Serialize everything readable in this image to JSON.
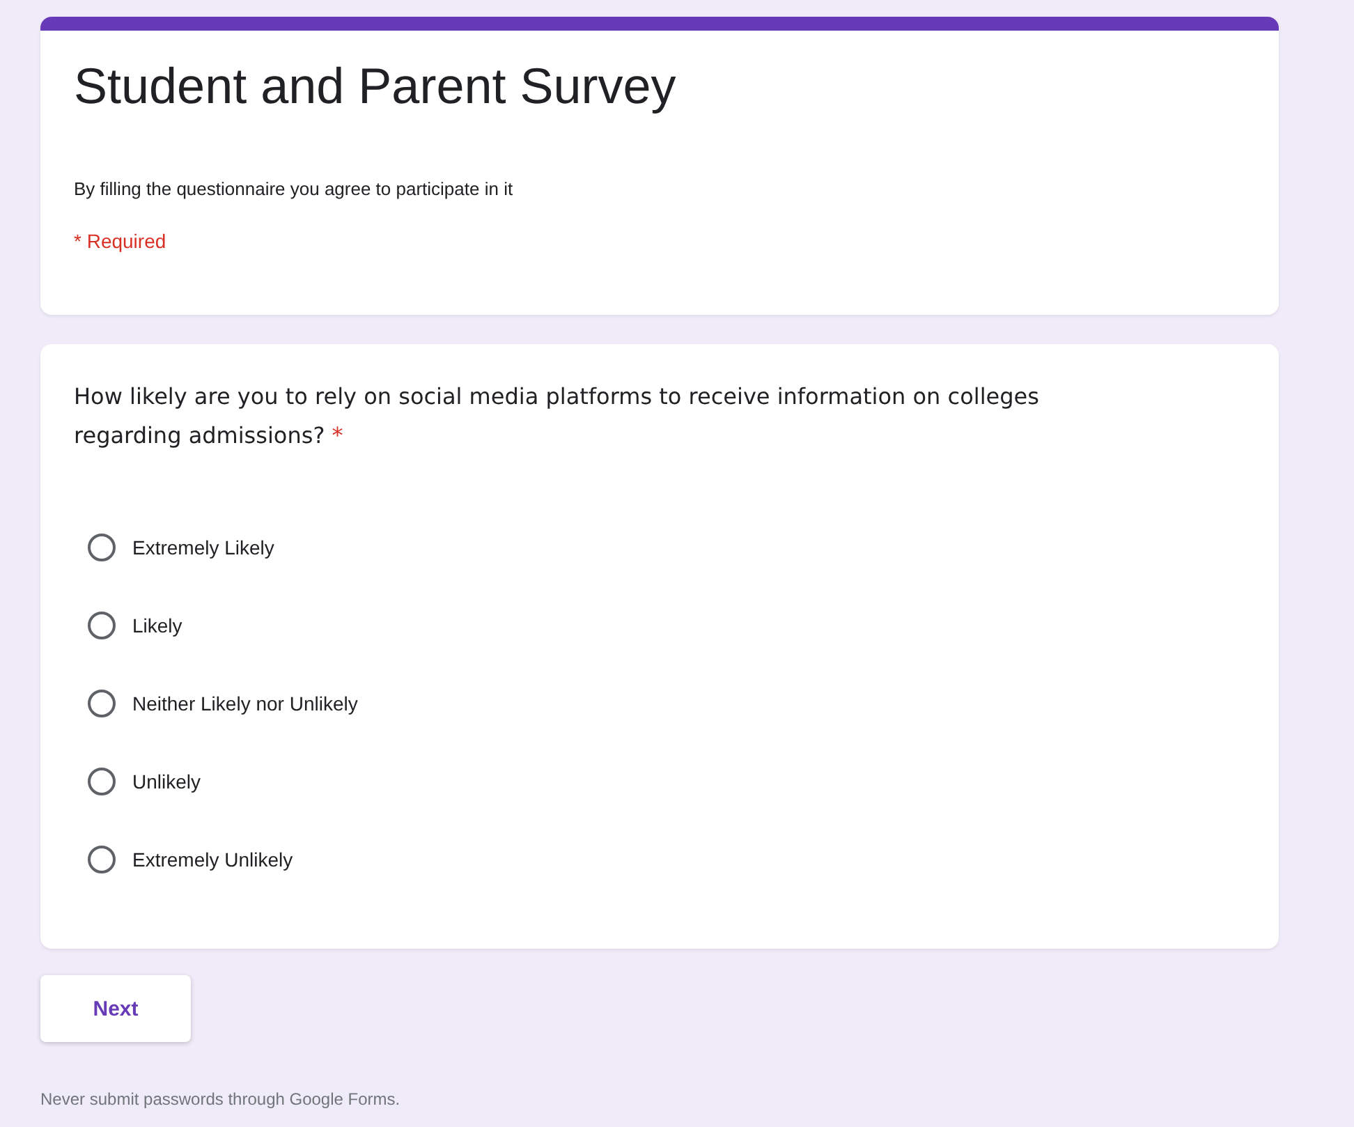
{
  "header": {
    "title": "Student and Parent Survey",
    "description": "By filling the questionnaire you agree to participate in it",
    "required_note": "* Required"
  },
  "question": {
    "text": "How likely are you to rely on social media platforms to receive information on colleges regarding admissions?",
    "required_mark": "*",
    "options": [
      {
        "label": "Extremely Likely",
        "selected": false
      },
      {
        "label": "Likely",
        "selected": false
      },
      {
        "label": "Neither Likely nor Unlikely",
        "selected": false
      },
      {
        "label": "Unlikely",
        "selected": false
      },
      {
        "label": "Extremely Unlikely",
        "selected": false
      }
    ]
  },
  "next_button": "Next",
  "footer": "Never submit passwords through Google Forms."
}
